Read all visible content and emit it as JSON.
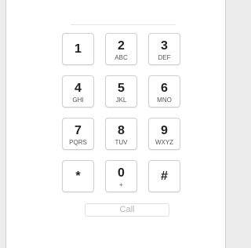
{
  "dialer": {
    "number_value": "",
    "keys": [
      {
        "digit": "1",
        "letters": ""
      },
      {
        "digit": "2",
        "letters": "ABC"
      },
      {
        "digit": "3",
        "letters": "DEF"
      },
      {
        "digit": "4",
        "letters": "GHI"
      },
      {
        "digit": "5",
        "letters": "JKL"
      },
      {
        "digit": "6",
        "letters": "MNO"
      },
      {
        "digit": "7",
        "letters": "PQRS"
      },
      {
        "digit": "8",
        "letters": "TUV"
      },
      {
        "digit": "9",
        "letters": "WXYZ"
      },
      {
        "digit": "*",
        "letters": ""
      },
      {
        "digit": "0",
        "letters": "+"
      },
      {
        "digit": "#",
        "letters": ""
      }
    ],
    "call_label": "Call"
  }
}
